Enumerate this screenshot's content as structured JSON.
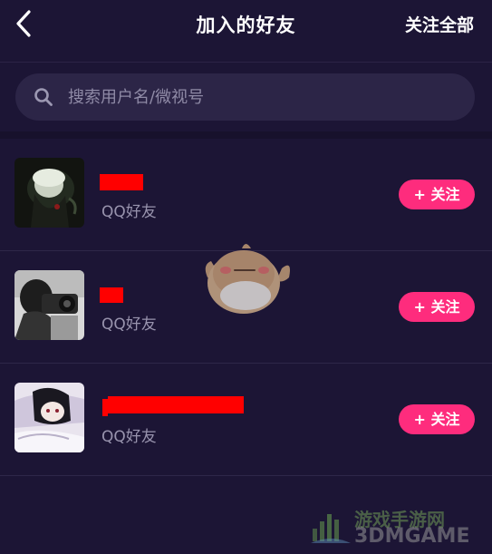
{
  "header": {
    "title": "加入的好友",
    "follow_all_label": "关注全部"
  },
  "search": {
    "placeholder": "搜索用户名/微视号"
  },
  "friends": [
    {
      "subtitle": "QQ好友",
      "follow_label": "+ 关注"
    },
    {
      "subtitle": "QQ好友",
      "follow_label": "+ 关注"
    },
    {
      "subtitle": "QQ好友",
      "follow_label": "+ 关注"
    }
  ],
  "watermark": {
    "logo_text_cn": "游戏手游网",
    "logo_text_en": "3DMGAME"
  },
  "colors": {
    "background": "#1c1535",
    "follow_button": "#fe2c7d",
    "redaction": "#ff0000"
  }
}
